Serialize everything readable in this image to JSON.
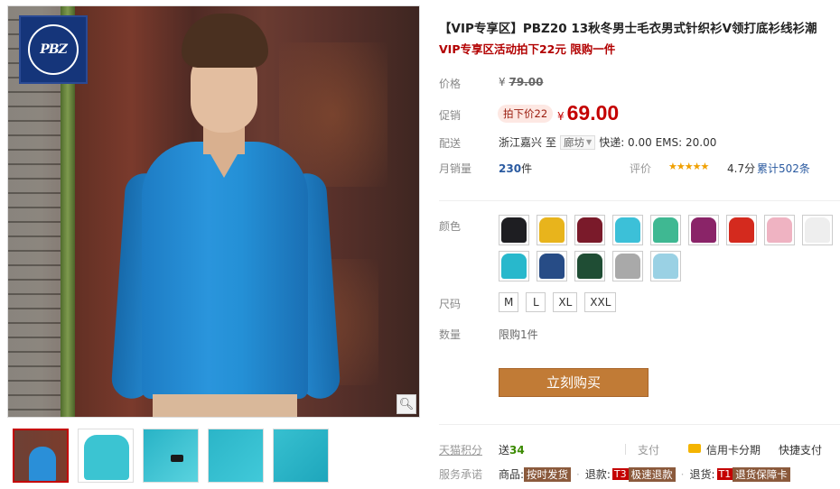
{
  "product": {
    "title": "【VIP专享区】PBZ20 13秋冬男士毛衣男式针织衫V领打底衫线衫潮",
    "subtitle": "VIP专享区活动拍下22元 限购一件",
    "brand_logo_text": "PBZ"
  },
  "labels": {
    "price": "价格",
    "promo": "促销",
    "shipping": "配送",
    "monthly_sales": "月销量",
    "rating": "评价",
    "color": "颜色",
    "size": "尺码",
    "quantity": "数量",
    "tmall_points": "天猫积分",
    "service": "服务承诺",
    "payment": "支付"
  },
  "price": {
    "currency": "¥",
    "original": "79.00",
    "promo_tag": "拍下价22",
    "promo": "69.00"
  },
  "shipping": {
    "from": "浙江嘉兴",
    "to_word": "至",
    "destination": "廊坊",
    "fees": "快递: 0.00 EMS: 20.00"
  },
  "sales": {
    "count": "230",
    "unit": "件"
  },
  "rating": {
    "stars": "★★★★★",
    "score": "4.7分",
    "total": "累计502条"
  },
  "colors": [
    {
      "name": "black",
      "hex": "#1e1e22"
    },
    {
      "name": "yellow",
      "hex": "#e8b41c"
    },
    {
      "name": "wine",
      "hex": "#7a1a2a"
    },
    {
      "name": "sky-blue",
      "hex": "#3cc0d8"
    },
    {
      "name": "mint",
      "hex": "#3fb892"
    },
    {
      "name": "purple",
      "hex": "#8a2468"
    },
    {
      "name": "red",
      "hex": "#d42a1e"
    },
    {
      "name": "pink",
      "hex": "#efb3c2"
    },
    {
      "name": "white",
      "hex": "#eeeeee"
    },
    {
      "name": "cyan",
      "hex": "#28b8cc"
    },
    {
      "name": "navy",
      "hex": "#274c86"
    },
    {
      "name": "dark-green",
      "hex": "#1f4d34"
    },
    {
      "name": "grey",
      "hex": "#a9a9a9"
    },
    {
      "name": "light-blue",
      "hex": "#9ad1e4"
    }
  ],
  "sizes": [
    "M",
    "L",
    "XL",
    "XXL"
  ],
  "quantity_note": "限购1件",
  "buy_button": "立刻购买",
  "points": {
    "prefix": "送",
    "value": "34"
  },
  "payment": {
    "card": "信用卡分期",
    "fast": "快捷支付"
  },
  "service": {
    "goods_label": "商品:",
    "goods_badge": "按时发货",
    "refund_label": "退款:",
    "refund_tag": "T3",
    "refund_badge": "极速退款",
    "return_label": "退货:",
    "return_tag": "T1",
    "return_badge": "退货保障卡"
  },
  "icons": {
    "zoom": "magnifier-icon",
    "stars": "star-rating-icon",
    "card": "credit-card-icon",
    "dropdown": "triangle-down-icon"
  }
}
